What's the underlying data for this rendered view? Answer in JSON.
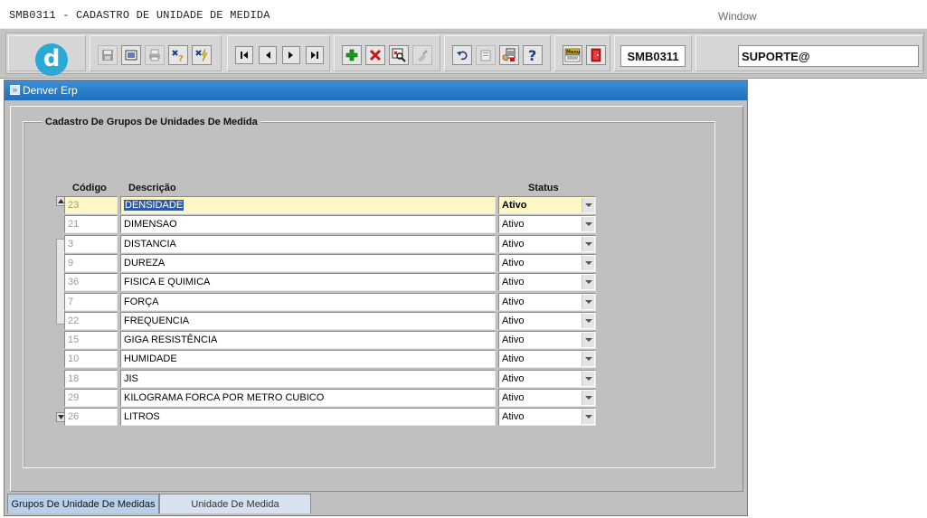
{
  "app": {
    "title": "SMB0311 - CADASTRO DE UNIDADE DE MEDIDA",
    "menu_window": "Window"
  },
  "toolbar": {
    "form_code": "SMB0311",
    "user": "SUPORTE@",
    "icons": [
      "save-icon",
      "print-preview-icon",
      "print-icon",
      "help-query-icon",
      "execute-icon",
      "first-record-icon",
      "previous-record-icon",
      "next-record-icon",
      "last-record-icon",
      "insert-record-icon",
      "delete-record-icon",
      "query-icon",
      "clear-icon",
      "undo-icon",
      "copy-icon",
      "list-values-icon",
      "help-icon",
      "menu-icon",
      "exit-icon"
    ]
  },
  "main_window": {
    "title": "Denver Erp",
    "group_title": "Cadastro De Grupos De Unidades De Medida",
    "columns": {
      "codigo": "Código",
      "descricao": "Descrição",
      "status": "Status"
    },
    "rows": [
      {
        "codigo": "23",
        "descricao": "DENSIDADE",
        "status": "Ativo"
      },
      {
        "codigo": "21",
        "descricao": "DIMENSAO",
        "status": "Ativo"
      },
      {
        "codigo": "3",
        "descricao": "DISTANCIA",
        "status": "Ativo"
      },
      {
        "codigo": "9",
        "descricao": "DUREZA",
        "status": "Ativo"
      },
      {
        "codigo": "36",
        "descricao": "FISICA E QUIMICA",
        "status": "Ativo"
      },
      {
        "codigo": "7",
        "descricao": "FORÇA",
        "status": "Ativo"
      },
      {
        "codigo": "22",
        "descricao": "FREQUENCIA",
        "status": "Ativo"
      },
      {
        "codigo": "15",
        "descricao": "GIGA RESISTÊNCIA",
        "status": "Ativo"
      },
      {
        "codigo": "10",
        "descricao": "HUMIDADE",
        "status": "Ativo"
      },
      {
        "codigo": "18",
        "descricao": "JIS",
        "status": "Ativo"
      },
      {
        "codigo": "29",
        "descricao": "KILOGRAMA FORCA POR METRO CUBICO",
        "status": "Ativo"
      },
      {
        "codigo": "26",
        "descricao": "LITROS",
        "status": "Ativo"
      }
    ],
    "tabs": [
      {
        "label": "Grupos De Unidade De Medidas"
      },
      {
        "label": "Unidade De Medida"
      }
    ]
  },
  "colors": {
    "titlebar": "#1f6fbf",
    "active_row": "#fef7c6",
    "selection": "#2f5aa0",
    "tab_active": "#b8d0ea"
  }
}
